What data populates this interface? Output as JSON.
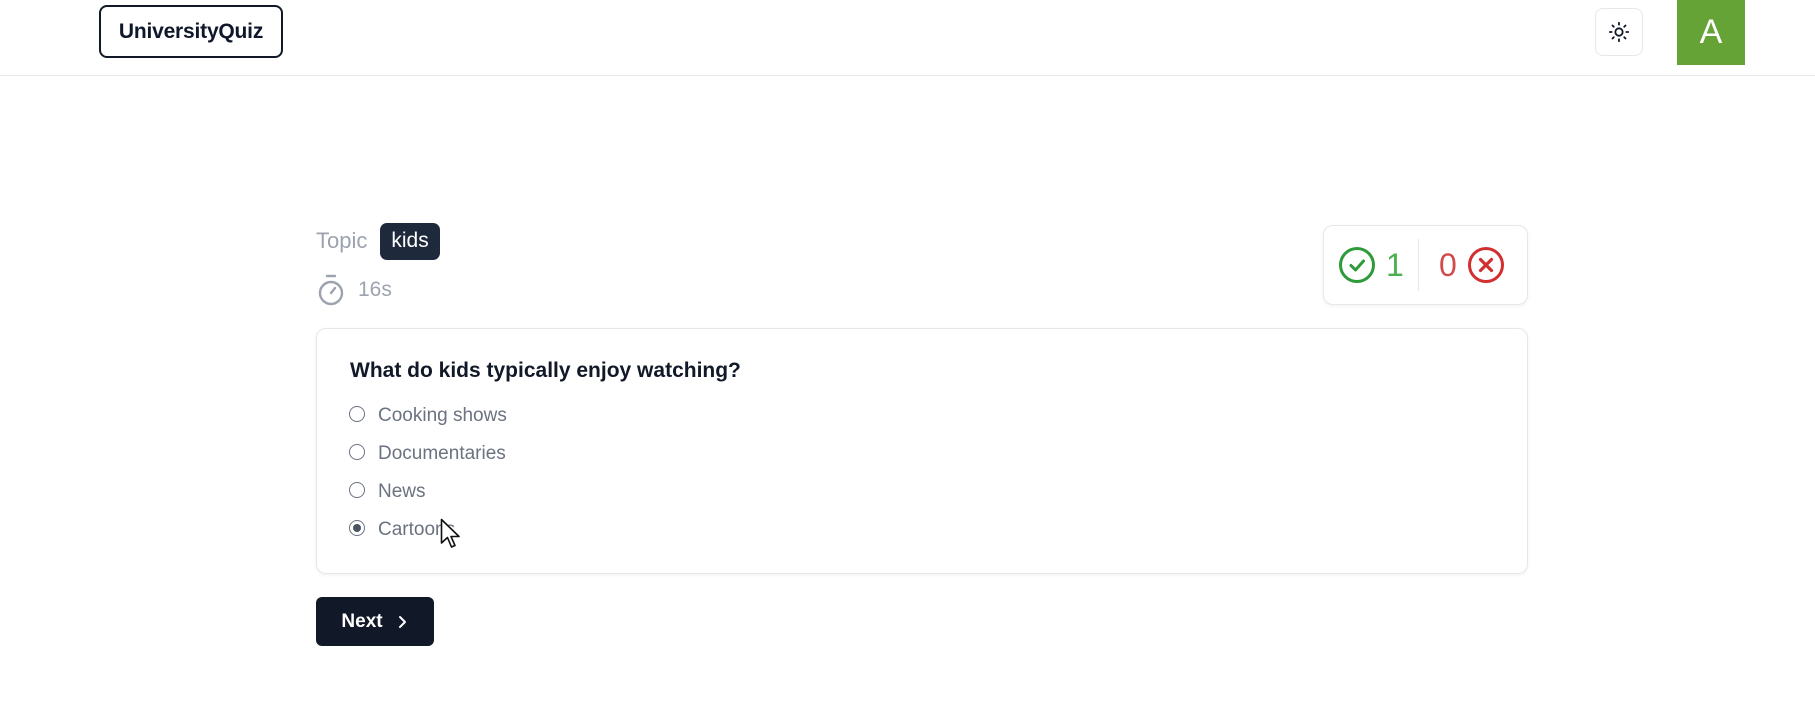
{
  "header": {
    "logo": "UniversityQuiz",
    "theme_toggle_icon": "sun-icon",
    "avatar_letter": "A",
    "avatar_color": "#65a336"
  },
  "quiz": {
    "topic_label": "Topic",
    "topic_value": "kids",
    "timer_icon": "stopwatch-icon",
    "timer_value": "16s",
    "score": {
      "correct": "1",
      "wrong": "0",
      "correct_color": "#2e9a3a",
      "wrong_color": "#d32f2f"
    },
    "question": "What do kids typically enjoy watching?",
    "options": [
      {
        "label": "Cooking shows",
        "selected": false
      },
      {
        "label": "Documentaries",
        "selected": false
      },
      {
        "label": "News",
        "selected": false
      },
      {
        "label": "Cartoons",
        "selected": true
      }
    ],
    "next_label": "Next"
  }
}
